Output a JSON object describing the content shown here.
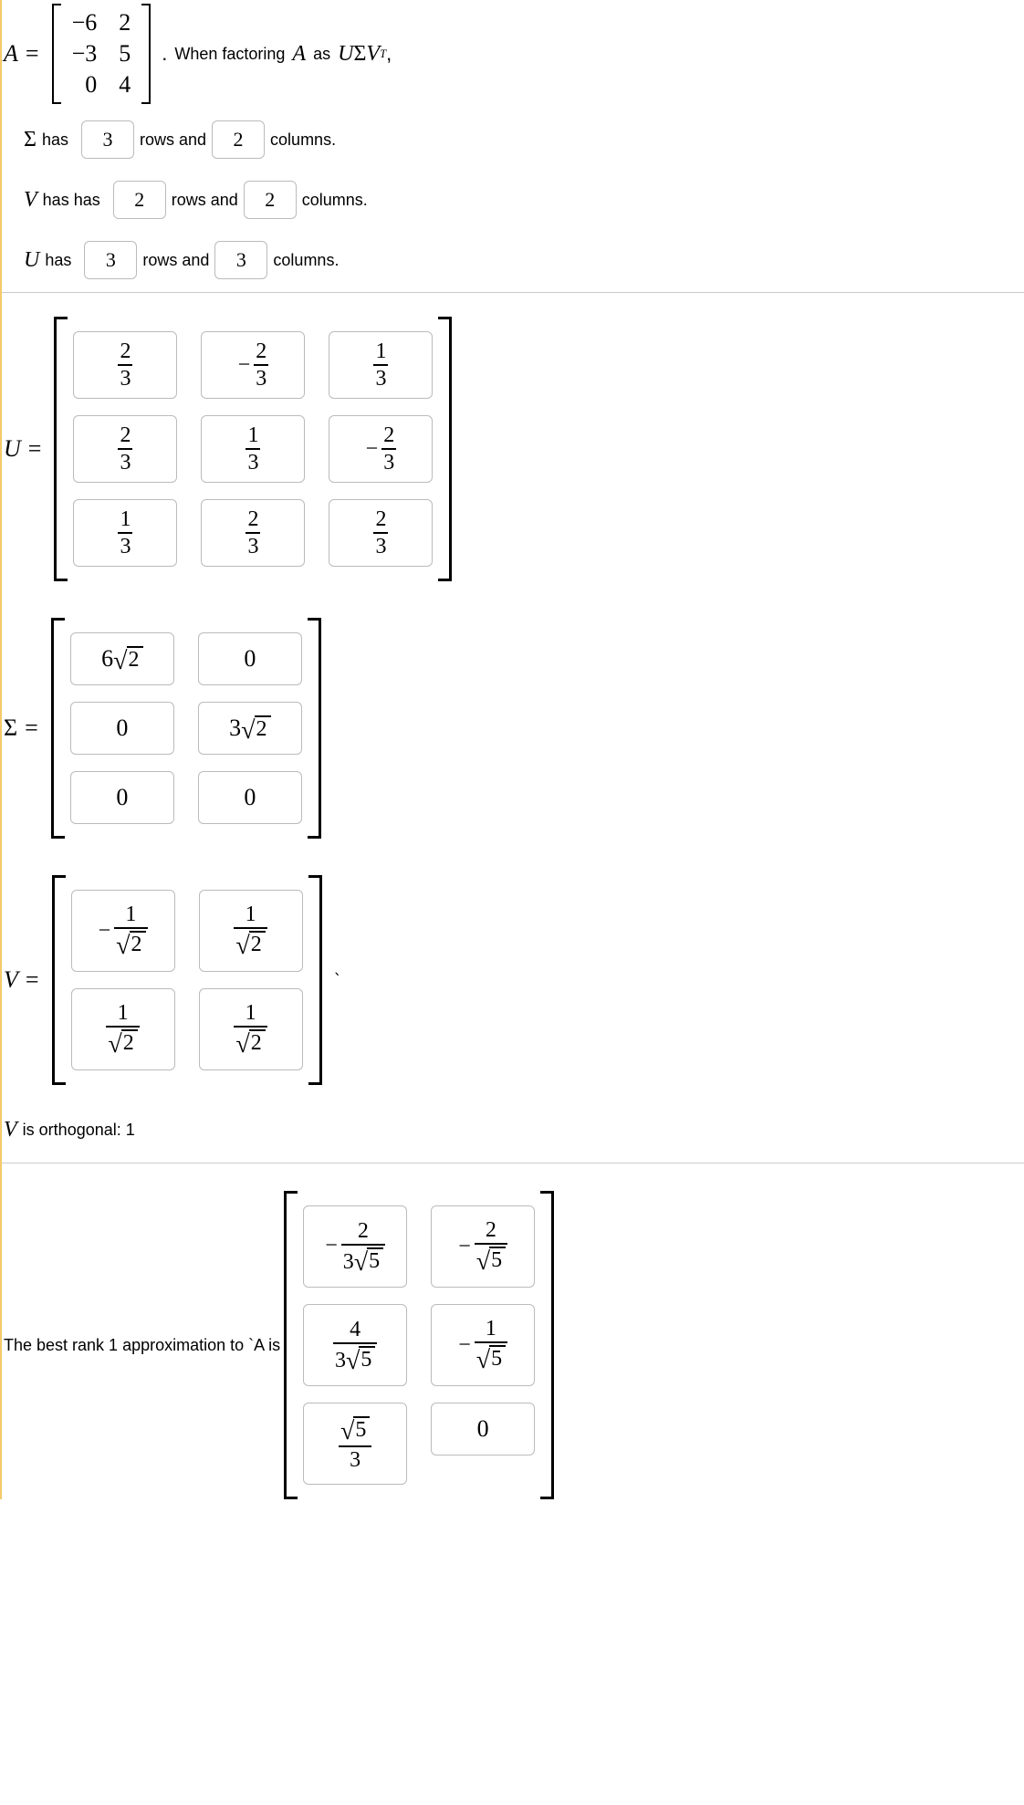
{
  "problem": {
    "A_label": "A",
    "equals": "=",
    "matrix_A": [
      [
        "−6",
        "2"
      ],
      [
        "−3",
        "5"
      ],
      [
        "0",
        "4"
      ]
    ],
    "period": ".",
    "factor_text_1": "When factoring",
    "factor_text_A": "A",
    "factor_text_2": "as",
    "factor_expr_U": "U",
    "factor_expr_Sigma": "Σ",
    "factor_expr_V": "V",
    "factor_expr_T": "T",
    "comma": ","
  },
  "dims": {
    "sigma": {
      "label": "Σ",
      "txt1": "has",
      "rows": "3",
      "txt2": "rows and",
      "cols": "2",
      "txt3": "columns."
    },
    "v": {
      "label": "V",
      "txt1": "has has",
      "rows": "2",
      "txt2": "rows and",
      "cols": "2",
      "txt3": "columns."
    },
    "u": {
      "label": "U",
      "txt1": "has",
      "rows": "3",
      "txt2": "rows and",
      "cols": "3",
      "txt3": "columns."
    }
  },
  "U": {
    "label": "U",
    "cells": [
      [
        {
          "type": "frac",
          "num": "2",
          "den": "3"
        },
        {
          "type": "negfrac",
          "num": "2",
          "den": "3"
        },
        {
          "type": "frac",
          "num": "1",
          "den": "3"
        }
      ],
      [
        {
          "type": "frac",
          "num": "2",
          "den": "3"
        },
        {
          "type": "frac",
          "num": "1",
          "den": "3"
        },
        {
          "type": "negfrac",
          "num": "2",
          "den": "3"
        }
      ],
      [
        {
          "type": "frac",
          "num": "1",
          "den": "3"
        },
        {
          "type": "frac",
          "num": "2",
          "den": "3"
        },
        {
          "type": "frac",
          "num": "2",
          "den": "3"
        }
      ]
    ]
  },
  "Sigma": {
    "label": "Σ",
    "cells": [
      [
        {
          "type": "ksqrt",
          "k": "6",
          "rad": "2"
        },
        {
          "type": "plain",
          "v": "0"
        }
      ],
      [
        {
          "type": "plain",
          "v": "0"
        },
        {
          "type": "ksqrt",
          "k": "3",
          "rad": "2"
        }
      ],
      [
        {
          "type": "plain",
          "v": "0"
        },
        {
          "type": "plain",
          "v": "0"
        }
      ]
    ]
  },
  "V": {
    "label": "V",
    "trailing": "`",
    "cells": [
      [
        {
          "type": "negfracsqrt",
          "num": "1",
          "den_rad": "2"
        },
        {
          "type": "fracsqrt",
          "num": "1",
          "den_rad": "2"
        }
      ],
      [
        {
          "type": "fracsqrt",
          "num": "1",
          "den_rad": "2"
        },
        {
          "type": "fracsqrt",
          "num": "1",
          "den_rad": "2"
        }
      ]
    ]
  },
  "orth": {
    "pre": "V",
    "text": "is orthogonal: 1"
  },
  "rank1": {
    "text": "The best rank 1 approximation to `A is",
    "cells": [
      [
        {
          "type": "negfracksqrt",
          "num": "2",
          "den_k": "3",
          "den_rad": "5"
        },
        {
          "type": "negfracsqrt",
          "num": "2",
          "den_rad": "5"
        }
      ],
      [
        {
          "type": "fracksqrt",
          "num": "4",
          "den_k": "3",
          "den_rad": "5"
        },
        {
          "type": "negfracsqrt",
          "num": "1",
          "den_rad": "5"
        }
      ],
      [
        {
          "type": "sqrtfrac",
          "num_rad": "5",
          "den": "3"
        },
        {
          "type": "plain",
          "v": "0"
        }
      ]
    ]
  }
}
